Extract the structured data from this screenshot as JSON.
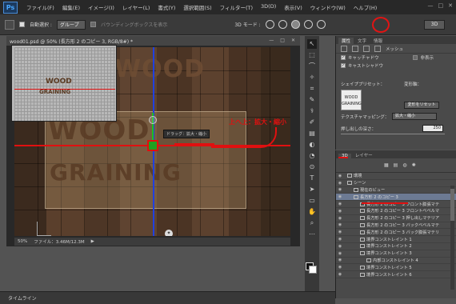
{
  "app": {
    "logo": "Ps"
  },
  "menu": [
    "ファイル(F)",
    "編集(E)",
    "イメージ(I)",
    "レイヤー(L)",
    "書式(Y)",
    "選択範囲(S)",
    "フィルター(T)",
    "3D(D)",
    "表示(V)",
    "ウィンドウ(W)",
    "ヘルプ(H)"
  ],
  "options": {
    "auto_select_label": "自動選択 :",
    "auto_select_value": "グループ",
    "bounding_box_label": "バウンディングボックスを表示",
    "mode_label": "3D モード :",
    "workspace": "3D"
  },
  "document": {
    "tab_title": "wood01.psd @ 50% (長方形 2 のコピー 3, RGB/8#) *",
    "canvas_text_line1": "WOOD",
    "canvas_text_line2": "GRAINING",
    "tooltip": "ドラッグ：拡大・縮小",
    "annotation": "上へ上：拡大・縮小",
    "zoom": "50%",
    "file_info": "ファイル：3.46M/12.3M",
    "thumb_line1": "WOOD",
    "thumb_line2": "GRAINING"
  },
  "tools": [
    "↖",
    "⬚",
    "⌒",
    "✧",
    "⌗",
    "✎",
    "⚕",
    "✐",
    "▤",
    "◐",
    "◔",
    "⊙",
    "T",
    "➤",
    "▭",
    "✋",
    "⌕",
    "⋯"
  ],
  "properties": {
    "tabs": [
      "属性",
      "文字",
      "情報"
    ],
    "mode_label": "メッシュ",
    "catch_shadow": "キャッチャドウ",
    "cast_shadow": "キャストシャドウ",
    "hidden_label": "非表示",
    "shape_preset_label": "シェイププリセット：",
    "deform_axis_label": "変形軸：",
    "transform_button": "変形をリセット",
    "texture_mapping_label": "テクスチャマッピング：",
    "texture_mapping_value": "拡大・縮小",
    "extrusion_depth_label": "押し出しの深さ：",
    "extrusion_depth_value": "250",
    "preset_thumb_text": "WOOD GRAINING"
  },
  "layers": {
    "tabs": [
      "3D",
      "レイヤー"
    ],
    "rows": [
      {
        "label": "環境",
        "indent": 0,
        "selected": false
      },
      {
        "label": "シーン",
        "indent": 0,
        "selected": false
      },
      {
        "label": "現在のビュー",
        "indent": 1,
        "selected": false
      },
      {
        "label": "長方形 2 のコピー 3",
        "indent": 1,
        "selected": true
      },
      {
        "label": "長方形 2 のコピー 3 フロント膨張マテ",
        "indent": 2,
        "selected": false
      },
      {
        "label": "長方形 2 のコピー 3 フロントベベルマ",
        "indent": 2,
        "selected": false
      },
      {
        "label": "長方形 2 のコピー 3 押し出しマテリア",
        "indent": 2,
        "selected": false
      },
      {
        "label": "長方形 2 のコピー 3 バックベベルマテ",
        "indent": 2,
        "selected": false
      },
      {
        "label": "長方形 2 のコピー 3 バック膨張マテリ",
        "indent": 2,
        "selected": false
      },
      {
        "label": "境界コンストレイント 1",
        "indent": 2,
        "selected": false
      },
      {
        "label": "境界コンストレイント 2",
        "indent": 2,
        "selected": false
      },
      {
        "label": "境界コンストレイント 3",
        "indent": 2,
        "selected": false
      },
      {
        "label": "内部コンストレイント 4",
        "indent": 3,
        "selected": false
      },
      {
        "label": "境界コンストレイント 5",
        "indent": 2,
        "selected": false
      },
      {
        "label": "境界コンストレイント 6",
        "indent": 2,
        "selected": false
      }
    ]
  },
  "timeline": {
    "label": "タイムライン"
  },
  "colors": {
    "accent_red": "#e01010",
    "axis_blue": "#2040e0",
    "axis_green": "#20c020",
    "selected_row": "#6c7a93"
  }
}
